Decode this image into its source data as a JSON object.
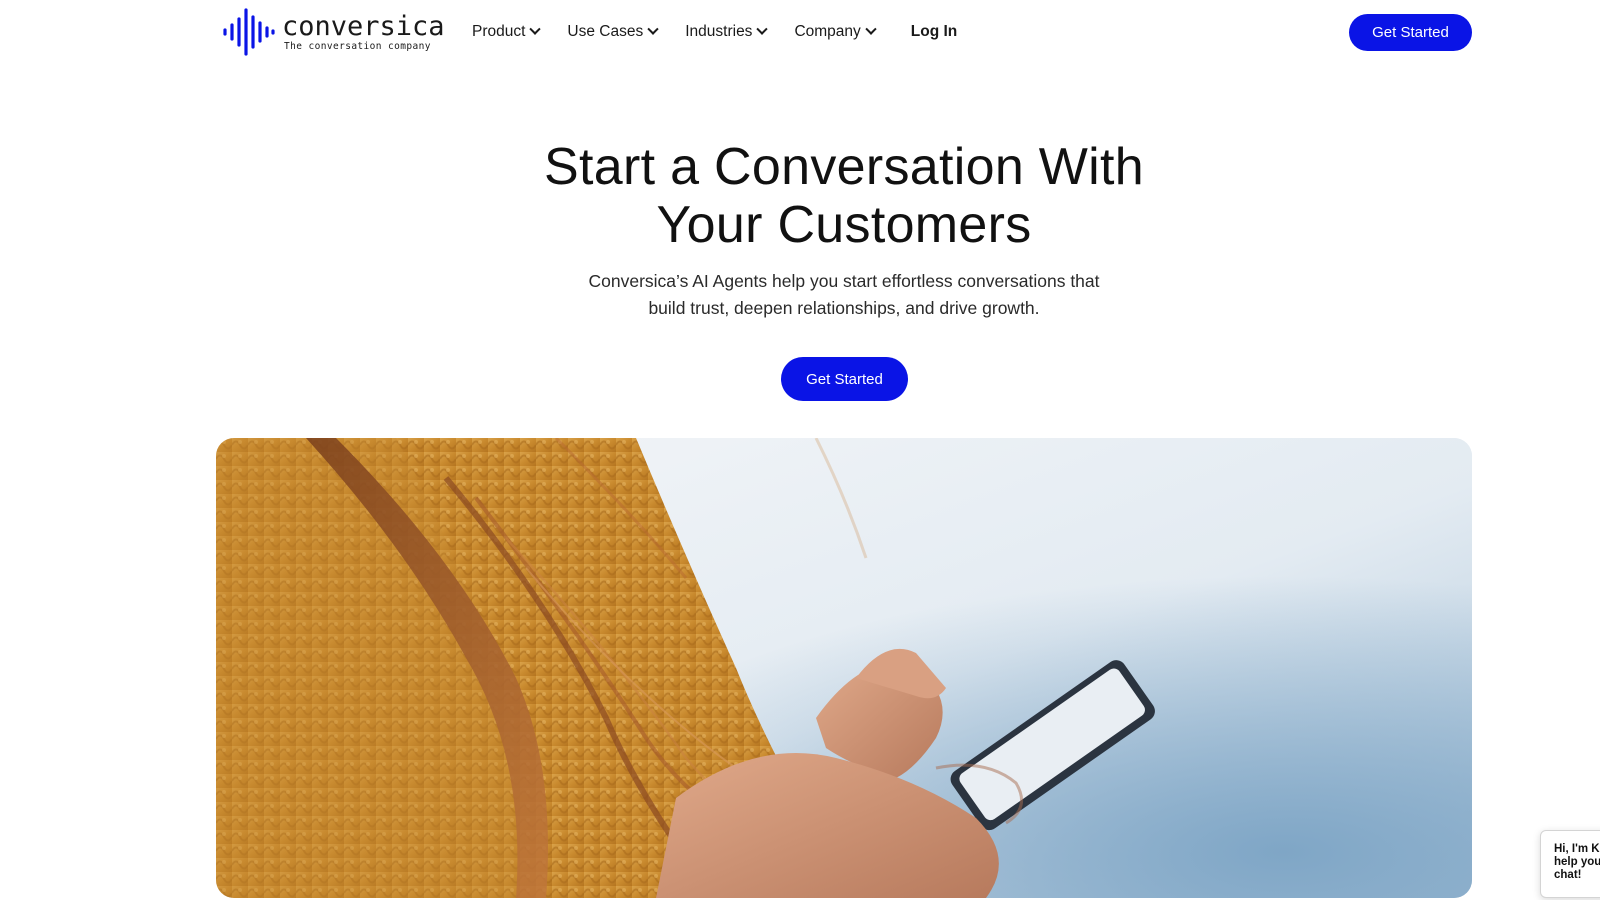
{
  "brand": {
    "name": "conversica",
    "tagline": "The conversation company",
    "accent_color": "#0a14e6",
    "logo_icon": "soundwave-icon"
  },
  "nav": {
    "items": [
      {
        "label": "Product",
        "icon": "chevron-down-icon"
      },
      {
        "label": "Use Cases",
        "icon": "chevron-down-icon"
      },
      {
        "label": "Industries",
        "icon": "chevron-down-icon"
      },
      {
        "label": "Company",
        "icon": "chevron-down-icon"
      }
    ],
    "login_label": "Log In",
    "cta_label": "Get Started"
  },
  "hero": {
    "title_line1": "Start a Conversation With",
    "title_line2": "Your Customers",
    "subtitle_line1": "Conversica’s AI Agents help you start effortless conversations that",
    "subtitle_line2": "build trust, deepen relationships, and drive growth.",
    "cta_label": "Get Started"
  },
  "chat_widget": {
    "text": "Hi, I'm K\nhelp you\nchat!"
  }
}
